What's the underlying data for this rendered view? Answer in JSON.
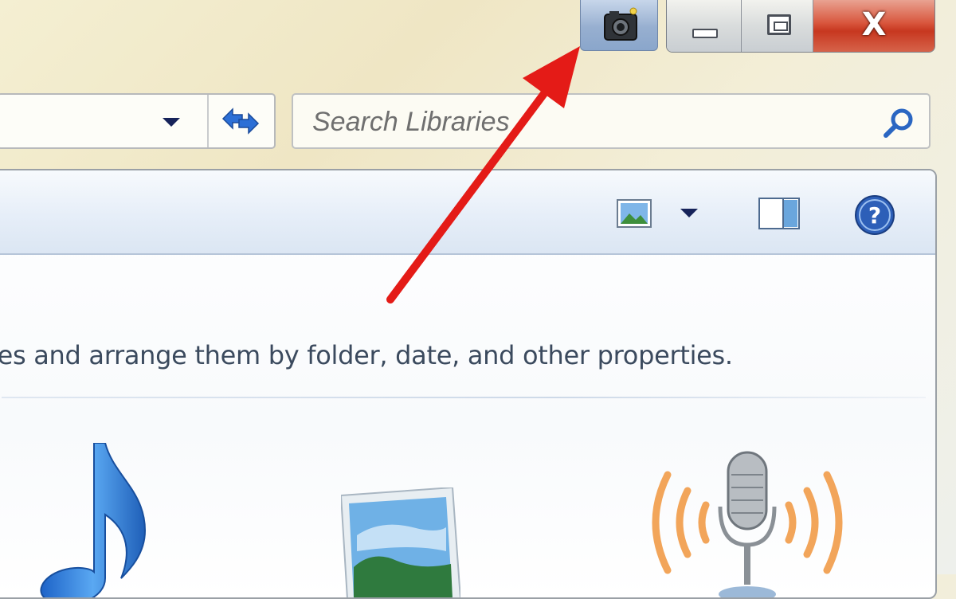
{
  "search": {
    "placeholder": "Search Libraries"
  },
  "main": {
    "description": "les and arrange them by folder, date, and other properties."
  },
  "icons": {
    "snapshot": "camera-icon",
    "minimize": "minimize-icon",
    "maximize": "maximize-icon",
    "close": "close-icon",
    "address_dropdown": "chevron-down-icon",
    "refresh": "refresh-icon",
    "search": "search-icon",
    "change_view": "picture-view-icon",
    "view_options": "chevron-down-icon",
    "preview_pane": "preview-pane-icon",
    "help": "help-icon",
    "libraries": [
      "music-note-icon",
      "pictures-icon",
      "podcast-microphone-icon"
    ]
  },
  "annotation": {
    "color": "#e41b17",
    "points_to": "camera-icon"
  },
  "titlebar": {
    "close_label": "X"
  }
}
